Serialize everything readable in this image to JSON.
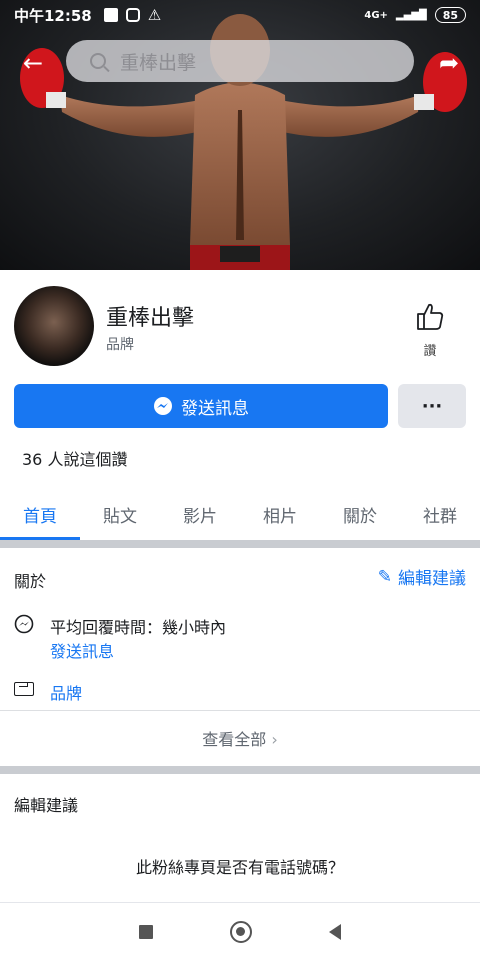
{
  "status_bar": {
    "time": "中午12:58",
    "network": "4G+",
    "battery": "85"
  },
  "search": {
    "placeholder": "重棒出擊"
  },
  "page": {
    "name": "重棒出擊",
    "category": "品牌",
    "like_label": "讚"
  },
  "actions": {
    "message_label": "發送訊息",
    "more_label": "···"
  },
  "likes_text": "36 人說這個讚",
  "tabs": [
    {
      "label": "首頁",
      "active": true
    },
    {
      "label": "貼文",
      "active": false
    },
    {
      "label": "影片",
      "active": false
    },
    {
      "label": "相片",
      "active": false
    },
    {
      "label": "關於",
      "active": false
    },
    {
      "label": "社群",
      "active": false
    }
  ],
  "about": {
    "title": "關於",
    "edit_label": "編輯建議",
    "response_time": "平均回覆時間：幾小時內",
    "response_link": "發送訊息",
    "category_link": "品牌",
    "see_all": "查看全部"
  },
  "suggest": {
    "title": "編輯建議",
    "question": "此粉絲專頁是否有電話號碼？"
  },
  "colors": {
    "accent": "#1877f2",
    "separator": "#c9ccd1"
  }
}
